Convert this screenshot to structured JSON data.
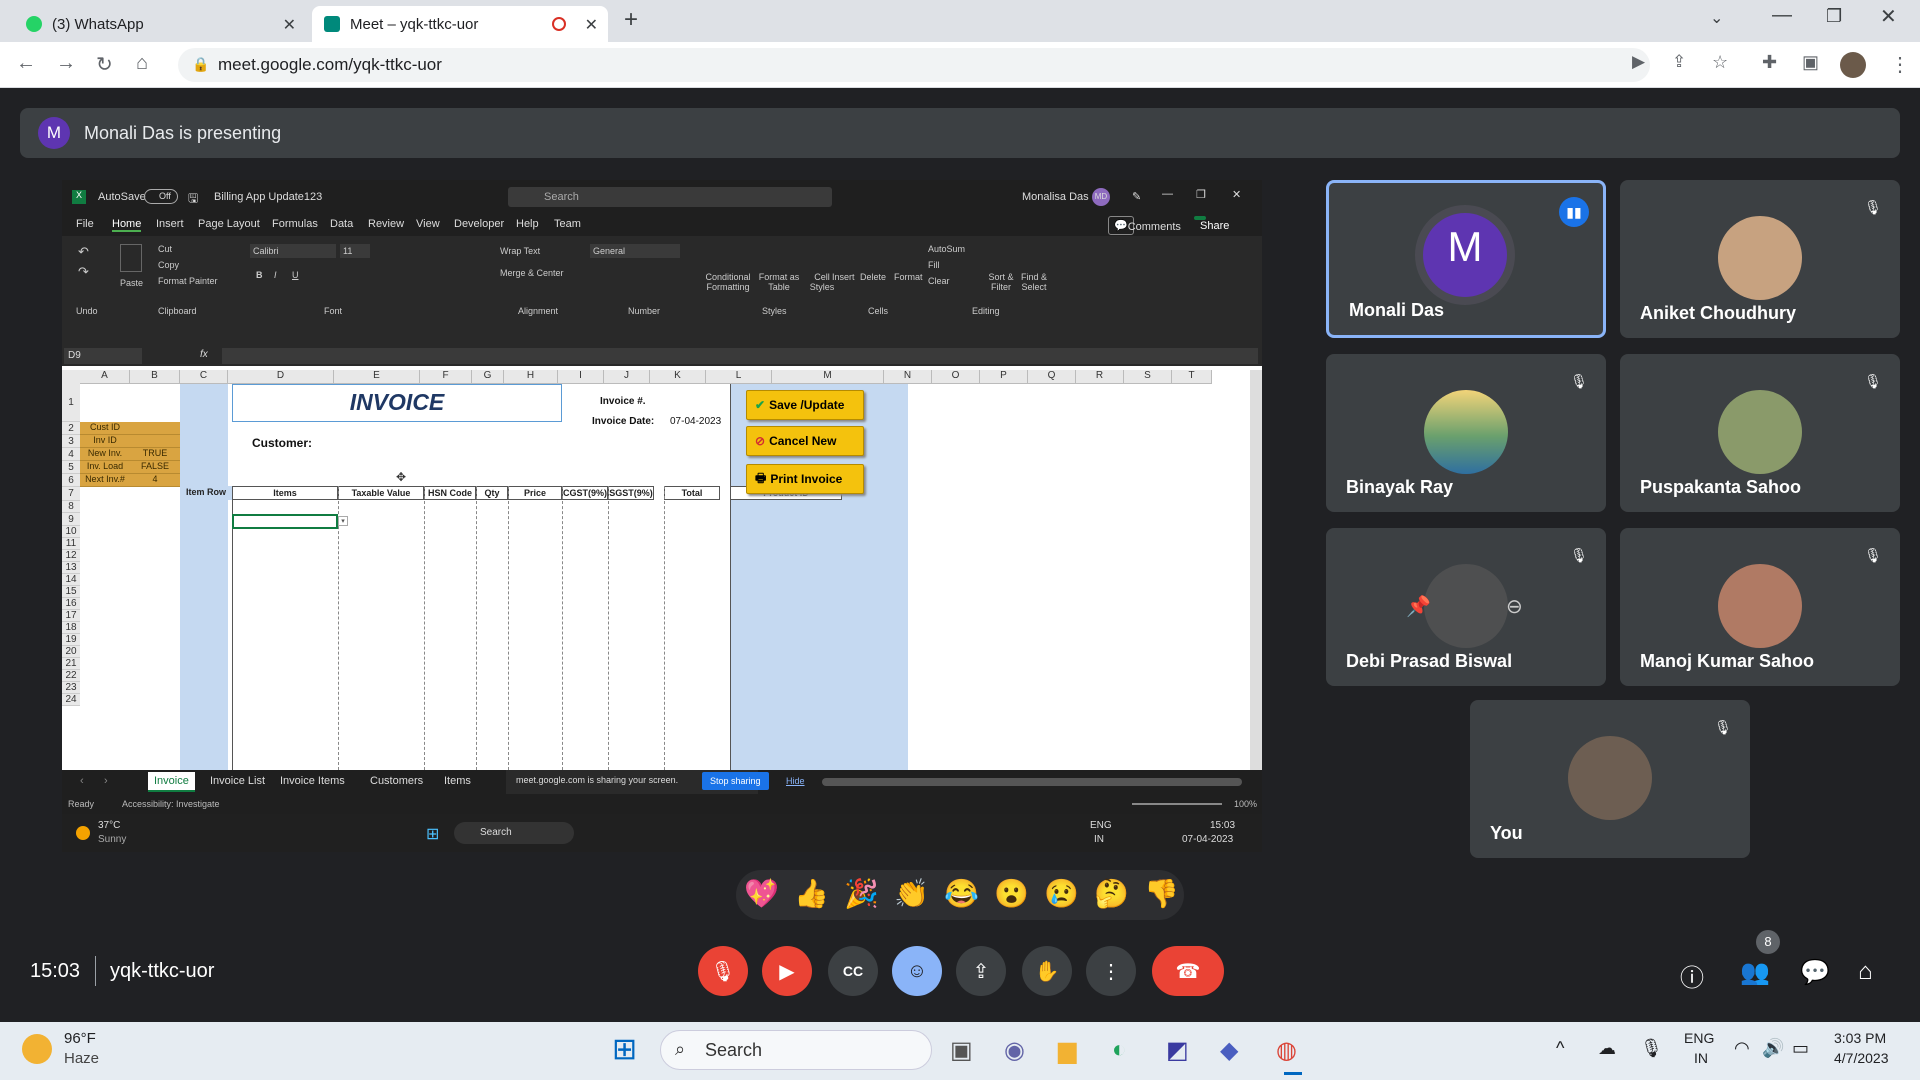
{
  "browser": {
    "tabs": [
      {
        "label": "(3) WhatsApp"
      },
      {
        "label": "Meet – yqk-ttkc-uor"
      }
    ],
    "url": "meet.google.com/yqk-ttkc-uor"
  },
  "meet": {
    "presenting_label": "Monali Das is presenting",
    "presenter_initial": "M",
    "time": "15:03",
    "meeting_code": "yqk-ttkc-uor",
    "participants_count": "8",
    "reactions": [
      "💖",
      "👍",
      "🎉",
      "👏",
      "😂",
      "😮",
      "😢",
      "🤔",
      "👎"
    ],
    "tiles": [
      {
        "name": "Monali Das"
      },
      {
        "name": "Aniket Choudhury"
      },
      {
        "name": "Binayak Ray"
      },
      {
        "name": "Puspakanta Sahoo"
      },
      {
        "name": "Debi Prasad Biswal"
      },
      {
        "name": "Manoj Kumar Sahoo"
      },
      {
        "name": "You"
      }
    ]
  },
  "excel": {
    "autosave": "AutoSave",
    "autosave_state": "Off",
    "filename": "Billing App Update123",
    "search": "Search",
    "user": "Monalisa Das",
    "user_initials": "MD",
    "menu": [
      "File",
      "Home",
      "Insert",
      "Page Layout",
      "Formulas",
      "Data",
      "Review",
      "View",
      "Developer",
      "Help",
      "Team"
    ],
    "comments": "Comments",
    "share": "Share",
    "ribbon": {
      "cut": "Cut",
      "copy": "Copy",
      "format_painter": "Format Painter",
      "paste": "Paste",
      "font": "Calibri",
      "size": "11",
      "wrap": "Wrap Text",
      "merge": "Merge & Center",
      "number_format": "General",
      "cond": "Conditional Formatting",
      "format_table": "Format as Table",
      "cell_styles": "Cell Styles",
      "insert": "Insert",
      "delete": "Delete",
      "format": "Format",
      "autosum": "AutoSum",
      "fill": "Fill",
      "clear": "Clear",
      "sort": "Sort & Filter",
      "find": "Find & Select",
      "groups": [
        "Undo",
        "Clipboard",
        "Font",
        "Alignment",
        "Number",
        "Styles",
        "Cells",
        "Editing"
      ]
    },
    "name_box": "D9",
    "columns": [
      "A",
      "B",
      "C",
      "D",
      "E",
      "F",
      "G",
      "H",
      "I",
      "J",
      "K",
      "L",
      "M",
      "N",
      "O",
      "P",
      "Q",
      "R",
      "S",
      "T"
    ],
    "rows": [
      "1",
      "2",
      "3",
      "4",
      "5",
      "6",
      "7",
      "8",
      "9",
      "10",
      "11",
      "12",
      "13",
      "14",
      "15",
      "16",
      "17",
      "18",
      "19",
      "20",
      "21",
      "22",
      "23",
      "24"
    ],
    "side_table": [
      [
        "Cust ID",
        ""
      ],
      [
        "Inv ID",
        ""
      ],
      [
        "New Inv.",
        "TRUE"
      ],
      [
        "Inv. Load",
        "FALSE"
      ],
      [
        "Next Inv.#",
        "4"
      ]
    ],
    "invoice_title": "INVOICE",
    "invoice_no_label": "Invoice #.",
    "invoice_date_label": "Invoice Date:",
    "invoice_date": "07-04-2023",
    "customer_label": "Customer:",
    "headers": [
      "Item Row",
      "Items",
      "Taxable Value",
      "HSN Code",
      "Qty",
      "Price",
      "CGST(9%)",
      "SGST(9%)",
      "Total",
      "Product ID"
    ],
    "buttons": [
      "Save /Update",
      "Cancel New",
      "Print Invoice"
    ],
    "sheets": [
      "Invoice",
      "Invoice List",
      "Invoice Items",
      "Customers",
      "Items"
    ],
    "sharing_msg": "meet.google.com is sharing your screen.",
    "stop_sharing": "Stop sharing",
    "hide": "Hide",
    "status_ready": "Ready",
    "accessibility": "Accessibility: Investigate",
    "zoom": "100%",
    "inner_weather": "37°C",
    "inner_weather_desc": "Sunny",
    "inner_search": "Search",
    "inner_lang": "ENG",
    "inner_region": "IN",
    "inner_time": "15:03",
    "inner_date": "07-04-2023"
  },
  "taskbar": {
    "weather": "96°F",
    "weather_desc": "Haze",
    "search": "Search",
    "lang": "ENG",
    "region": "IN",
    "time": "3:03 PM",
    "date": "4/7/2023"
  },
  "colors": {
    "accent": "#8ab4f8",
    "danger": "#ea4335",
    "excel_yellow": "#d9a441"
  }
}
